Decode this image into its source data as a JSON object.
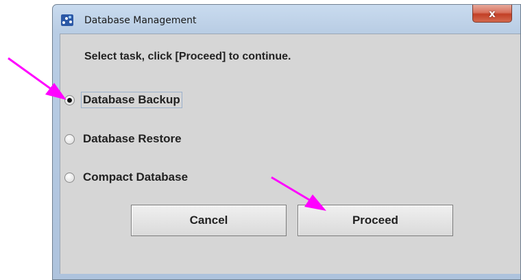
{
  "window": {
    "title": "Database Management",
    "close_label": "x",
    "app_icon": "database-app-icon"
  },
  "dialog": {
    "instruction": "Select task, click [Proceed] to continue.",
    "options": [
      {
        "label": "Database Backup",
        "selected": true
      },
      {
        "label": "Database Restore",
        "selected": false
      },
      {
        "label": "Compact Database",
        "selected": false
      }
    ],
    "cancel_label": "Cancel",
    "proceed_label": "Proceed"
  },
  "annotations": {
    "arrow_color": "#ff00ff"
  },
  "colors": {
    "dialog_background": "#d6d6d6",
    "frame": "#b9cde4",
    "close_button": "#c8452c"
  }
}
